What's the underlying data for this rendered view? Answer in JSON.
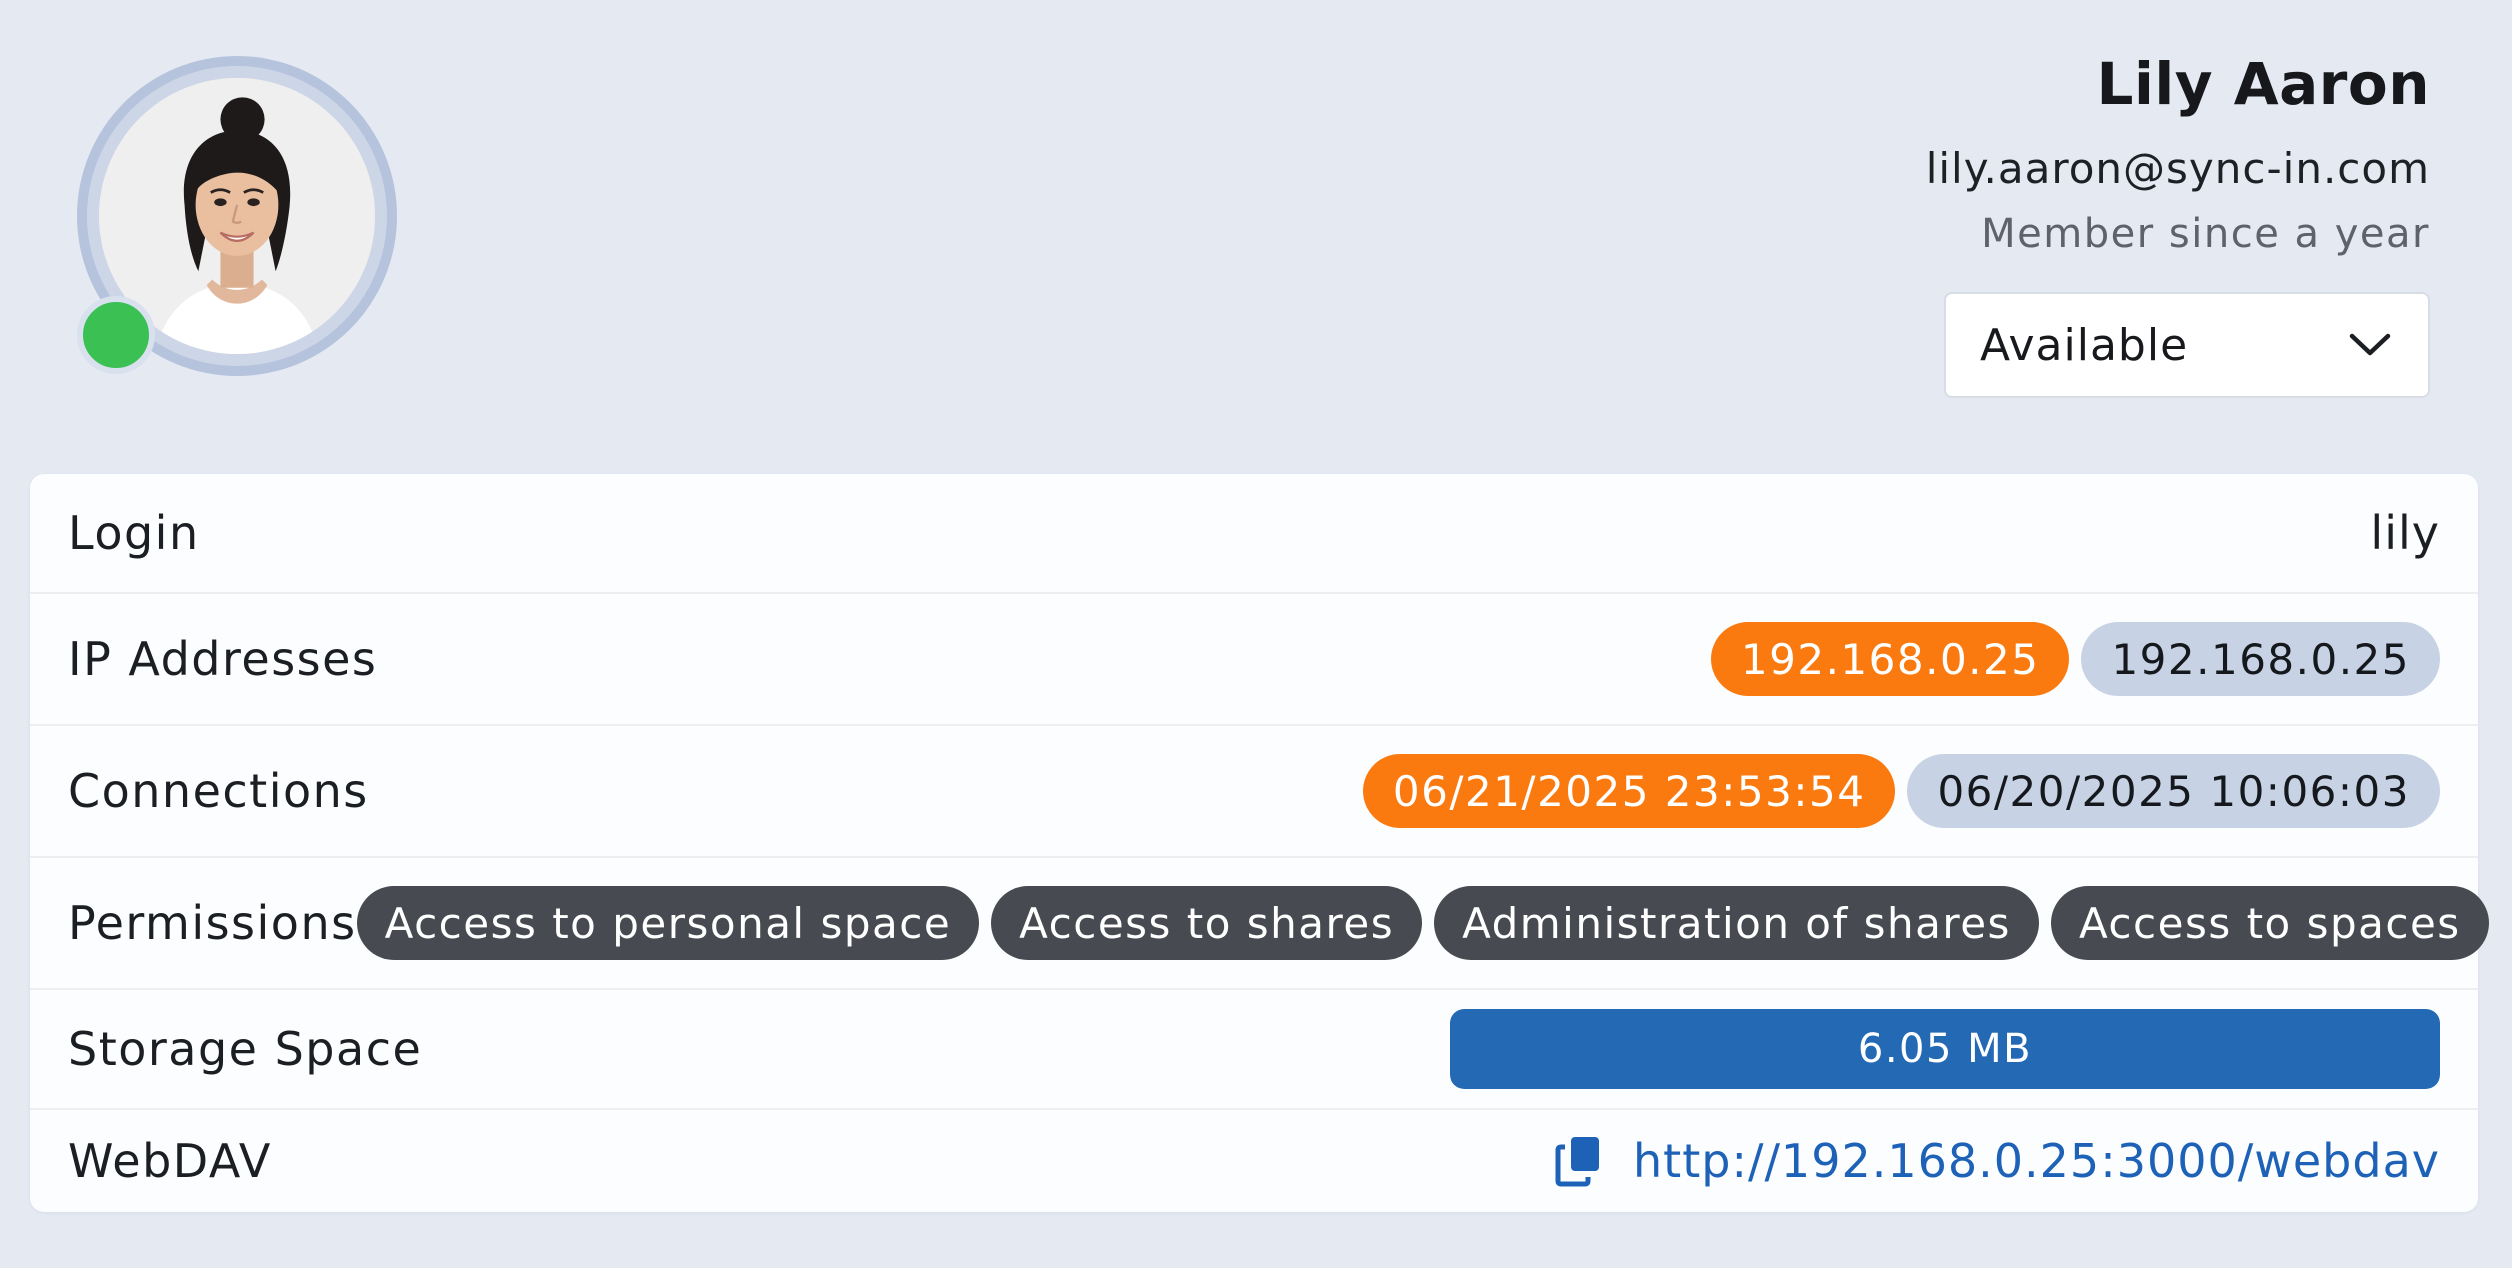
{
  "profile": {
    "name": "Lily Aaron",
    "email": "lily.aaron@sync-in.com",
    "member_since": "Member since a year",
    "presence_color": "#3ac053"
  },
  "status_select": {
    "value": "Available",
    "icon": "chevron-down-icon"
  },
  "details": {
    "login": {
      "label": "Login",
      "value": "lily"
    },
    "ip_addresses": {
      "label": "IP Addresses",
      "items": [
        {
          "text": "192.168.0.25",
          "style": "orange"
        },
        {
          "text": "192.168.0.25",
          "style": "grey"
        }
      ]
    },
    "connections": {
      "label": "Connections",
      "items": [
        {
          "text": "06/21/2025 23:53:54",
          "style": "orange"
        },
        {
          "text": "06/20/2025 10:06:03",
          "style": "grey"
        }
      ]
    },
    "permissions": {
      "label": "Permissions",
      "items": [
        "Access to personal space",
        "Access to shares",
        "Administration of shares",
        "Access to spaces"
      ]
    },
    "storage": {
      "label": "Storage Space",
      "value": "6.05 MB",
      "fill_fraction": 1.0
    },
    "webdav": {
      "label": "WebDAV",
      "url": "http://192.168.0.25:3000/webdav",
      "icon": "copy-icon"
    }
  },
  "colors": {
    "accent_orange": "#fb7a10",
    "pill_grey": "#c7d3e5",
    "pill_dark": "#474b51",
    "storage_blue": "#2469b4",
    "link_blue": "#1e62b8"
  }
}
